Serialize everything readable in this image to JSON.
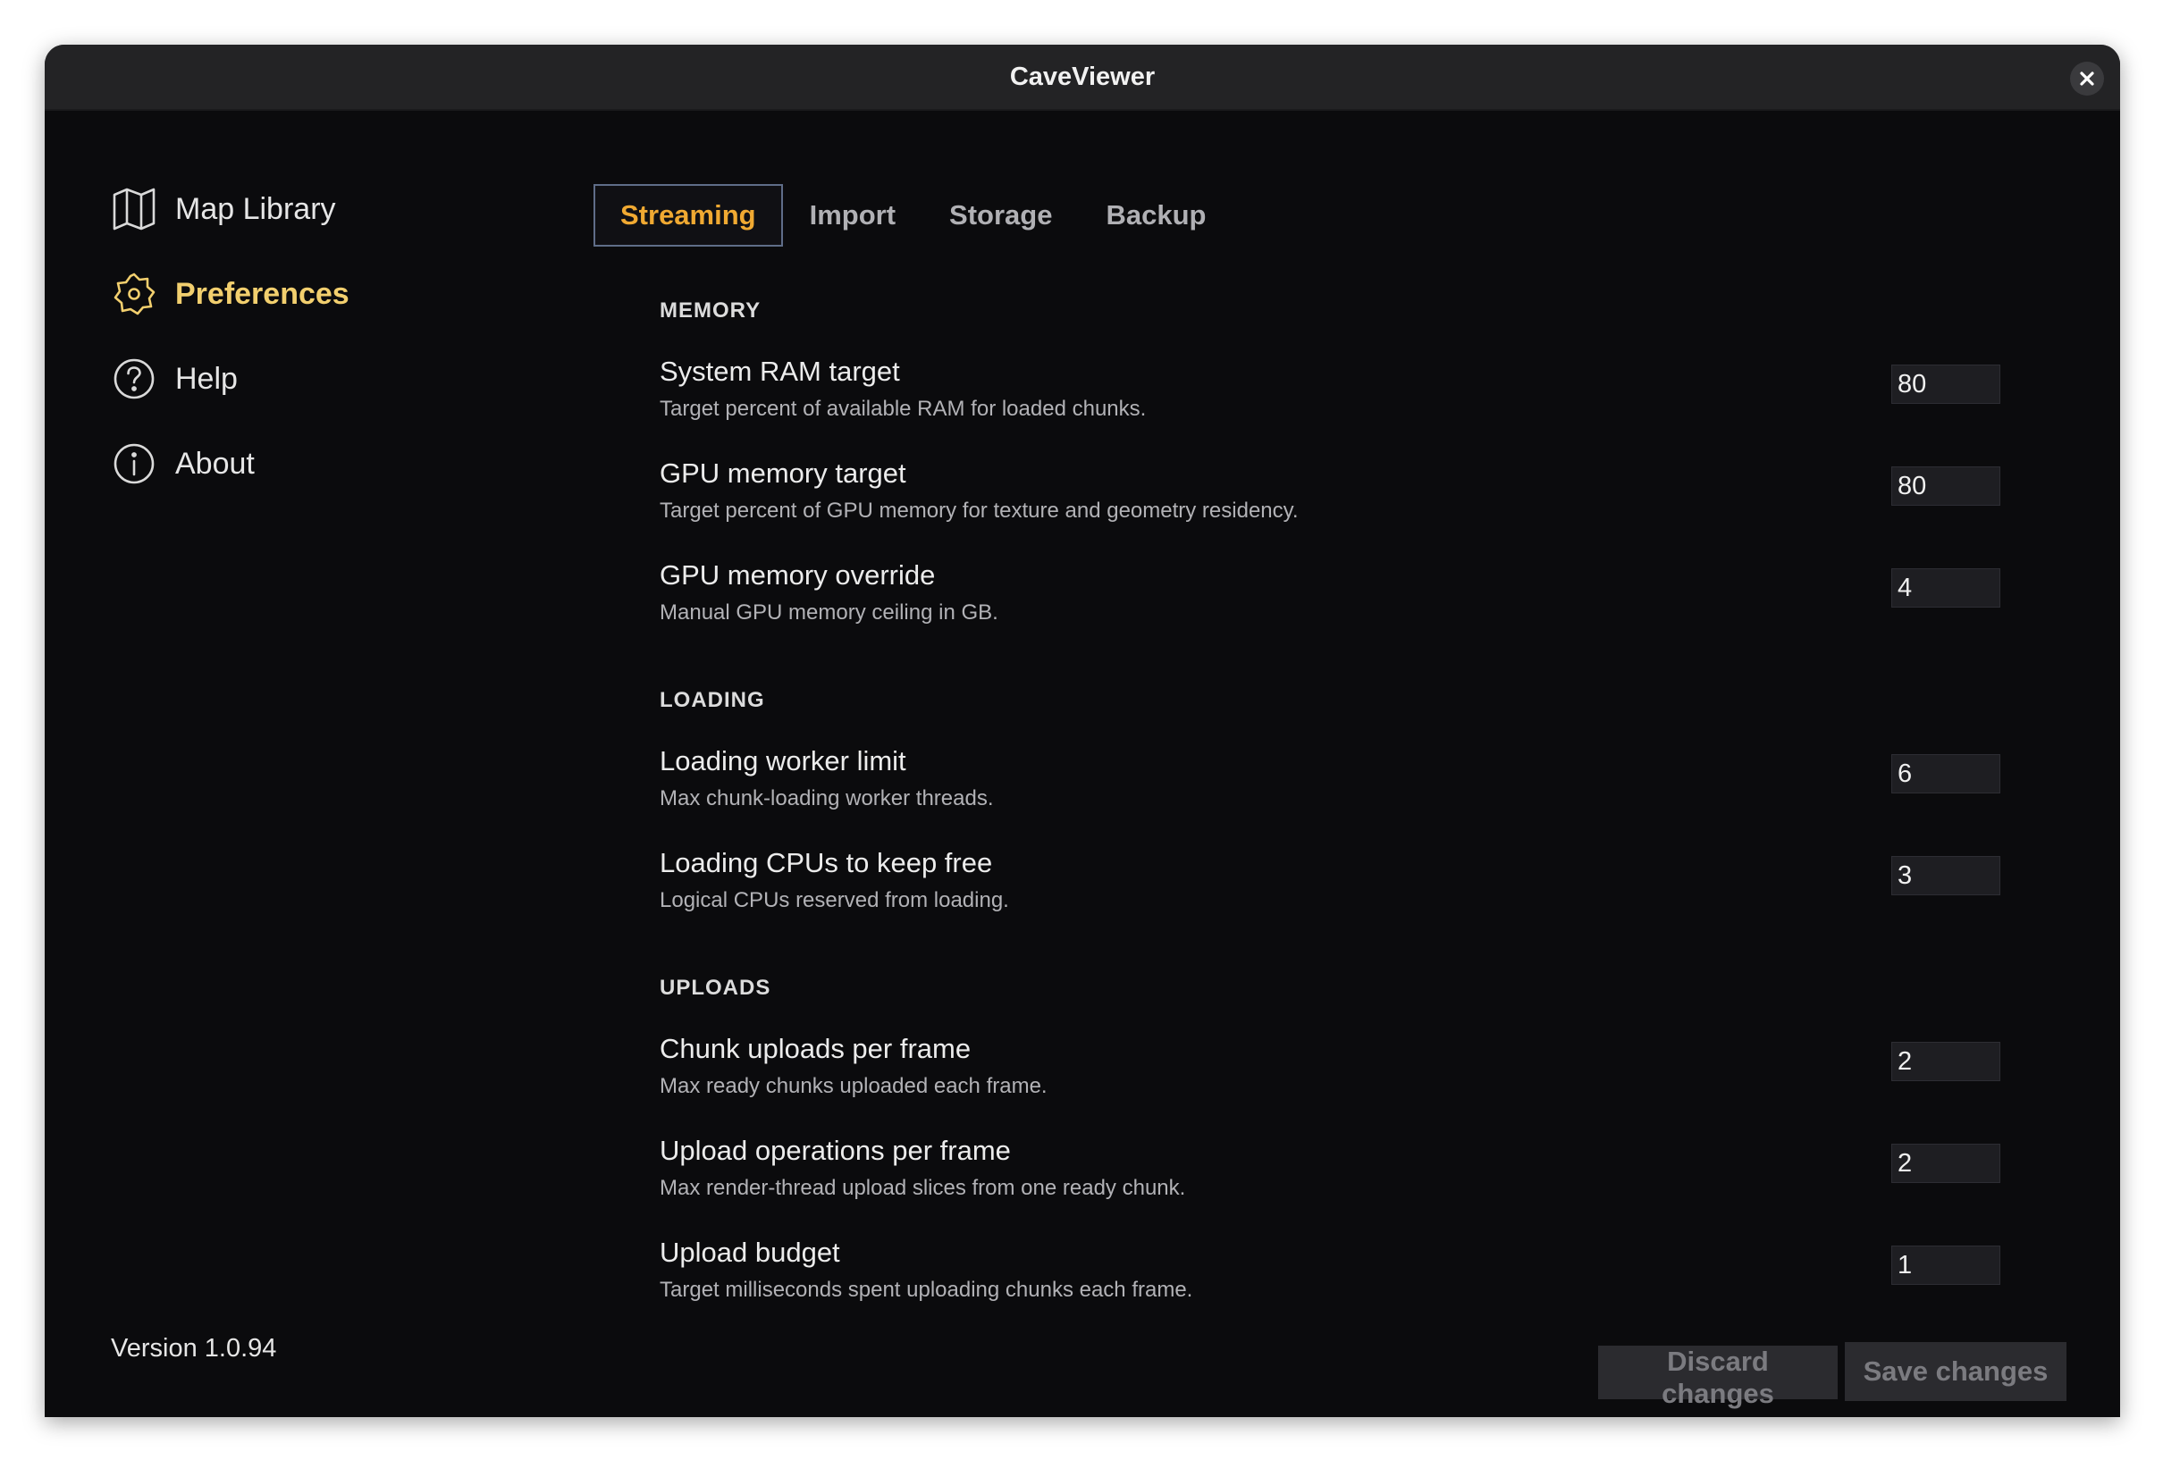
{
  "window": {
    "title": "CaveViewer"
  },
  "sidebar": {
    "items": [
      {
        "label": "Map Library",
        "icon": "map-icon",
        "active": false
      },
      {
        "label": "Preferences",
        "icon": "gear-icon",
        "active": true
      },
      {
        "label": "Help",
        "icon": "help-circle-icon",
        "active": false
      },
      {
        "label": "About",
        "icon": "info-circle-icon",
        "active": false
      }
    ],
    "version": "Version 1.0.94"
  },
  "tabs": [
    {
      "label": "Streaming",
      "active": true
    },
    {
      "label": "Import",
      "active": false
    },
    {
      "label": "Storage",
      "active": false
    },
    {
      "label": "Backup",
      "active": false
    }
  ],
  "sections": {
    "memory": {
      "title": "MEMORY",
      "settings": [
        {
          "label": "System RAM target",
          "description": "Target percent of available RAM for loaded chunks.",
          "value": "80"
        },
        {
          "label": "GPU memory target",
          "description": "Target percent of GPU memory for texture and geometry residency.",
          "value": "80"
        },
        {
          "label": "GPU memory override",
          "description": "Manual GPU memory ceiling in GB.",
          "value": "4"
        }
      ]
    },
    "loading": {
      "title": "LOADING",
      "settings": [
        {
          "label": "Loading worker limit",
          "description": "Max chunk-loading worker threads.",
          "value": "6"
        },
        {
          "label": "Loading CPUs to keep free",
          "description": "Logical CPUs reserved from loading.",
          "value": "3"
        }
      ]
    },
    "uploads": {
      "title": "UPLOADS",
      "settings": [
        {
          "label": "Chunk uploads per frame",
          "description": "Max ready chunks uploaded each frame.",
          "value": "2"
        },
        {
          "label": "Upload operations per frame",
          "description": "Max render-thread upload slices from one ready chunk.",
          "value": "2"
        },
        {
          "label": "Upload budget",
          "description": "Target milliseconds spent uploading chunks each frame.",
          "value": "1"
        }
      ]
    }
  },
  "actions": {
    "discard_label": "Discard changes",
    "save_label": "Save changes"
  },
  "colors": {
    "accent_active_tab": "#f0a932",
    "accent_active_nav": "#f2cf6e",
    "background": "#0b0b0d"
  }
}
